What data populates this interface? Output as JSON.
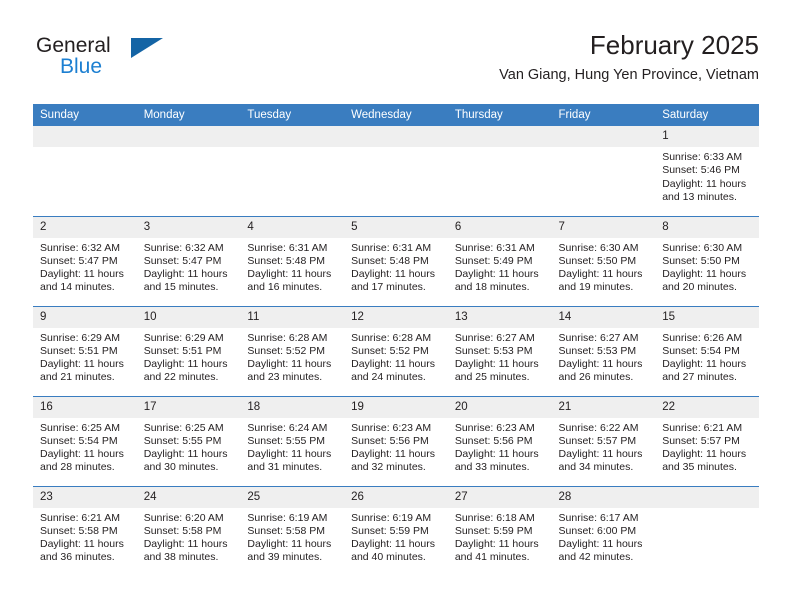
{
  "brand": {
    "name_top": "General",
    "name_bottom": "Blue",
    "triangle_color": "#1464a5",
    "blue_color": "#1c7fd1"
  },
  "header": {
    "title": "February 2025",
    "subtitle": "Van Giang, Hung Yen Province, Vietnam"
  },
  "theme": {
    "header_bg": "#3a7dc0",
    "daynum_bg": "#efefef",
    "text": "#231f20"
  },
  "weekday_headers": [
    "Sunday",
    "Monday",
    "Tuesday",
    "Wednesday",
    "Thursday",
    "Friday",
    "Saturday"
  ],
  "weeks": [
    [
      {
        "blank": true
      },
      {
        "blank": true
      },
      {
        "blank": true
      },
      {
        "blank": true
      },
      {
        "blank": true
      },
      {
        "blank": true
      },
      {
        "day": "1",
        "sunrise": "Sunrise: 6:33 AM",
        "sunset": "Sunset: 5:46 PM",
        "daylight": "Daylight: 11 hours and 13 minutes."
      }
    ],
    [
      {
        "day": "2",
        "sunrise": "Sunrise: 6:32 AM",
        "sunset": "Sunset: 5:47 PM",
        "daylight": "Daylight: 11 hours and 14 minutes."
      },
      {
        "day": "3",
        "sunrise": "Sunrise: 6:32 AM",
        "sunset": "Sunset: 5:47 PM",
        "daylight": "Daylight: 11 hours and 15 minutes."
      },
      {
        "day": "4",
        "sunrise": "Sunrise: 6:31 AM",
        "sunset": "Sunset: 5:48 PM",
        "daylight": "Daylight: 11 hours and 16 minutes."
      },
      {
        "day": "5",
        "sunrise": "Sunrise: 6:31 AM",
        "sunset": "Sunset: 5:48 PM",
        "daylight": "Daylight: 11 hours and 17 minutes."
      },
      {
        "day": "6",
        "sunrise": "Sunrise: 6:31 AM",
        "sunset": "Sunset: 5:49 PM",
        "daylight": "Daylight: 11 hours and 18 minutes."
      },
      {
        "day": "7",
        "sunrise": "Sunrise: 6:30 AM",
        "sunset": "Sunset: 5:50 PM",
        "daylight": "Daylight: 11 hours and 19 minutes."
      },
      {
        "day": "8",
        "sunrise": "Sunrise: 6:30 AM",
        "sunset": "Sunset: 5:50 PM",
        "daylight": "Daylight: 11 hours and 20 minutes."
      }
    ],
    [
      {
        "day": "9",
        "sunrise": "Sunrise: 6:29 AM",
        "sunset": "Sunset: 5:51 PM",
        "daylight": "Daylight: 11 hours and 21 minutes."
      },
      {
        "day": "10",
        "sunrise": "Sunrise: 6:29 AM",
        "sunset": "Sunset: 5:51 PM",
        "daylight": "Daylight: 11 hours and 22 minutes."
      },
      {
        "day": "11",
        "sunrise": "Sunrise: 6:28 AM",
        "sunset": "Sunset: 5:52 PM",
        "daylight": "Daylight: 11 hours and 23 minutes."
      },
      {
        "day": "12",
        "sunrise": "Sunrise: 6:28 AM",
        "sunset": "Sunset: 5:52 PM",
        "daylight": "Daylight: 11 hours and 24 minutes."
      },
      {
        "day": "13",
        "sunrise": "Sunrise: 6:27 AM",
        "sunset": "Sunset: 5:53 PM",
        "daylight": "Daylight: 11 hours and 25 minutes."
      },
      {
        "day": "14",
        "sunrise": "Sunrise: 6:27 AM",
        "sunset": "Sunset: 5:53 PM",
        "daylight": "Daylight: 11 hours and 26 minutes."
      },
      {
        "day": "15",
        "sunrise": "Sunrise: 6:26 AM",
        "sunset": "Sunset: 5:54 PM",
        "daylight": "Daylight: 11 hours and 27 minutes."
      }
    ],
    [
      {
        "day": "16",
        "sunrise": "Sunrise: 6:25 AM",
        "sunset": "Sunset: 5:54 PM",
        "daylight": "Daylight: 11 hours and 28 minutes."
      },
      {
        "day": "17",
        "sunrise": "Sunrise: 6:25 AM",
        "sunset": "Sunset: 5:55 PM",
        "daylight": "Daylight: 11 hours and 30 minutes."
      },
      {
        "day": "18",
        "sunrise": "Sunrise: 6:24 AM",
        "sunset": "Sunset: 5:55 PM",
        "daylight": "Daylight: 11 hours and 31 minutes."
      },
      {
        "day": "19",
        "sunrise": "Sunrise: 6:23 AM",
        "sunset": "Sunset: 5:56 PM",
        "daylight": "Daylight: 11 hours and 32 minutes."
      },
      {
        "day": "20",
        "sunrise": "Sunrise: 6:23 AM",
        "sunset": "Sunset: 5:56 PM",
        "daylight": "Daylight: 11 hours and 33 minutes."
      },
      {
        "day": "21",
        "sunrise": "Sunrise: 6:22 AM",
        "sunset": "Sunset: 5:57 PM",
        "daylight": "Daylight: 11 hours and 34 minutes."
      },
      {
        "day": "22",
        "sunrise": "Sunrise: 6:21 AM",
        "sunset": "Sunset: 5:57 PM",
        "daylight": "Daylight: 11 hours and 35 minutes."
      }
    ],
    [
      {
        "day": "23",
        "sunrise": "Sunrise: 6:21 AM",
        "sunset": "Sunset: 5:58 PM",
        "daylight": "Daylight: 11 hours and 36 minutes."
      },
      {
        "day": "24",
        "sunrise": "Sunrise: 6:20 AM",
        "sunset": "Sunset: 5:58 PM",
        "daylight": "Daylight: 11 hours and 38 minutes."
      },
      {
        "day": "25",
        "sunrise": "Sunrise: 6:19 AM",
        "sunset": "Sunset: 5:58 PM",
        "daylight": "Daylight: 11 hours and 39 minutes."
      },
      {
        "day": "26",
        "sunrise": "Sunrise: 6:19 AM",
        "sunset": "Sunset: 5:59 PM",
        "daylight": "Daylight: 11 hours and 40 minutes."
      },
      {
        "day": "27",
        "sunrise": "Sunrise: 6:18 AM",
        "sunset": "Sunset: 5:59 PM",
        "daylight": "Daylight: 11 hours and 41 minutes."
      },
      {
        "day": "28",
        "sunrise": "Sunrise: 6:17 AM",
        "sunset": "Sunset: 6:00 PM",
        "daylight": "Daylight: 11 hours and 42 minutes."
      },
      {
        "blank": true
      }
    ]
  ]
}
